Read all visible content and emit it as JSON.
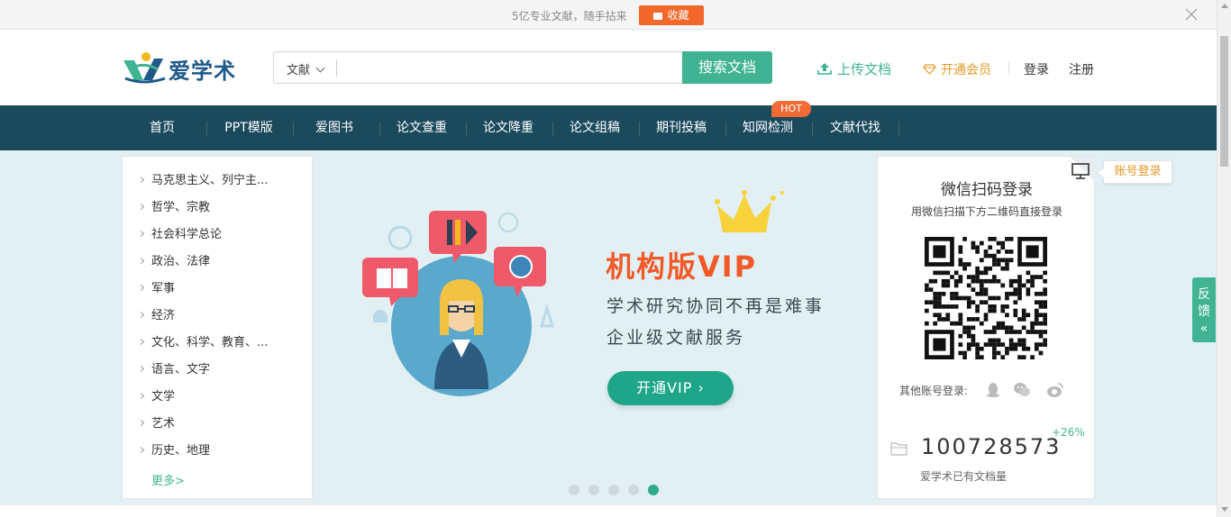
{
  "notice": {
    "text": "5亿专业文献，随手拈来",
    "favorite_label": "收藏"
  },
  "header": {
    "logo_text": "爱学术",
    "search_type": "文献",
    "search_placeholder": "",
    "search_button": "搜索文档",
    "upload_label": "上传文档",
    "vip_label": "开通会员",
    "login_label": "登录",
    "register_label": "注册"
  },
  "nav": {
    "items": [
      "首页",
      "PPT模版",
      "爱图书",
      "论文查重",
      "论文降重",
      "论文组稿",
      "期刊投稿",
      "知网检测",
      "文献代找"
    ],
    "hot_badge": "HOT"
  },
  "categories": {
    "items": [
      "马克思主义、列宁主...",
      "哲学、宗教",
      "社会科学总论",
      "政治、法律",
      "军事",
      "经济",
      "文化、科学、教育、...",
      "语言、文字",
      "文学",
      "艺术",
      "历史、地理"
    ],
    "more_label": "更多>"
  },
  "banner": {
    "title": "机构版VIP",
    "line1": "学术研究协同不再是难事",
    "line2": "企业级文献服务",
    "button": "开通VIP ›",
    "slide_count": 5,
    "active_slide": 5
  },
  "login_panel": {
    "title": "微信扫码登录",
    "subtitle": "用微信扫描下方二维码直接登录",
    "other_login": "其他账号登录:",
    "account_login": "账号登录",
    "doc_count": "100728573",
    "growth": "+26%",
    "doc_label": "爱学术已有文档量"
  },
  "feedback": {
    "label1": "反",
    "label2": "馈",
    "label3": "«"
  },
  "colors": {
    "accent": "#3fb392",
    "nav_bg": "#1b4a5c",
    "orange": "#f2682a",
    "banner_bg": "#e2f0f3"
  }
}
